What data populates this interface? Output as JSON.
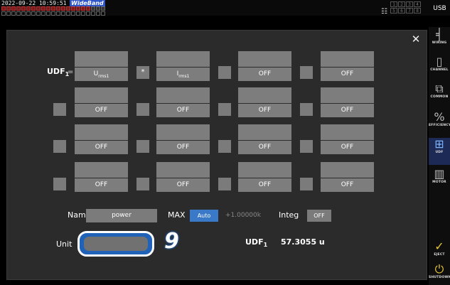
{
  "status": {
    "datetime": "2022-09-22 10:59:51",
    "mode": "WideBand",
    "usb": "USB",
    "pages": [
      "1",
      "2",
      "3",
      "4",
      "5",
      "6",
      "7",
      "8"
    ]
  },
  "sidebar": [
    {
      "label": "WIRING",
      "icon": "wiring-icon"
    },
    {
      "label": "CHANNEL",
      "icon": "channel-icon"
    },
    {
      "label": "COMMON",
      "icon": "common-icon"
    },
    {
      "label": "EFFICIENCY",
      "icon": "efficiency-icon"
    },
    {
      "label": "UDF",
      "icon": "udf-icon"
    },
    {
      "label": "MOTOR",
      "icon": "motor-icon"
    },
    {
      "label": "EJECT",
      "icon": "eject-icon"
    },
    {
      "label": "SHUTDOWN",
      "icon": "shutdown-icon"
    }
  ],
  "dialog": {
    "udf_name": "UDF",
    "udf_index": "1",
    "equals": "=",
    "row1": {
      "term1": {
        "base": "U",
        "sub": "rms1"
      },
      "op1": "*",
      "term2": {
        "base": "I",
        "sub": "rms1"
      },
      "term3": "OFF",
      "term4": "OFF"
    },
    "grid_rows": [
      [
        "OFF",
        "OFF",
        "OFF",
        "OFF"
      ],
      [
        "OFF",
        "OFF",
        "OFF",
        "OFF"
      ],
      [
        "OFF",
        "OFF",
        "OFF",
        "OFF"
      ]
    ],
    "name_label": "Name",
    "name_value": "power",
    "max_label": "MAX",
    "max_mode": "Auto",
    "max_value": "+1.00000k",
    "integ_label": "Integ",
    "integ_value": "OFF",
    "unit_label": "Unit",
    "unit_value": "",
    "callout": "9",
    "result_name": "UDF",
    "result_index": "1",
    "result_value": "57.3055 u"
  }
}
